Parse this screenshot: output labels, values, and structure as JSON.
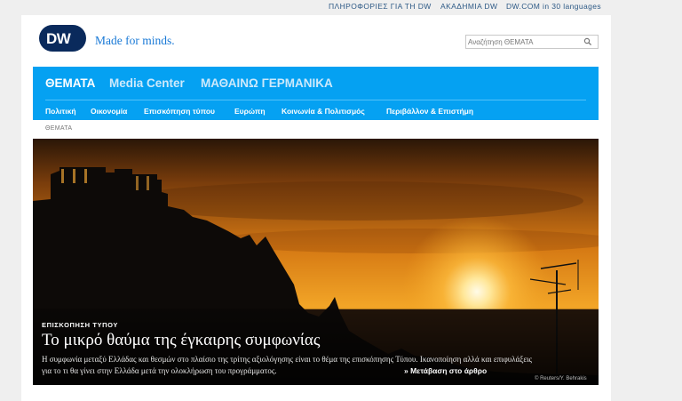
{
  "top_links": [
    {
      "label": "ΠΛΗΡΟΦΟΡΙΕΣ ΓΙΑ ΤΗ DW"
    },
    {
      "label": "ΑΚΑΔΗΜΙΑ DW"
    },
    {
      "label": "DW.COM in 30 languages"
    }
  ],
  "logo": {
    "text": "DW",
    "tagline": "Made for minds.",
    "color": "#0a2a5c"
  },
  "search": {
    "placeholder": "Αναζήτηση ΘΕΜΑΤΑ",
    "value": "",
    "icon": "search-icon"
  },
  "nav": {
    "accent": "#05a1f2",
    "primary": [
      {
        "label": "ΘΕΜΑΤΑ",
        "active": true
      },
      {
        "label": "Media Center",
        "active": false
      },
      {
        "label": "ΜΑΘΑΙΝΩ ΓΕΡΜΑΝΙΚΑ",
        "active": false
      }
    ],
    "secondary": [
      {
        "label": "Πολιτική"
      },
      {
        "label": "Οικονομία"
      },
      {
        "label": "Επισκόπηση τύπου"
      },
      {
        "label": "Ευρώπη"
      },
      {
        "label": "Κοινωνία & Πολιτισμός"
      },
      {
        "label": "Περιβάλλον & Επιστήμη"
      }
    ]
  },
  "breadcrumb": "ΘΕΜΑΤΑ",
  "hero": {
    "kicker": "ΕΠΙΣΚΟΠΗΣΗ ΤΥΠΟΥ",
    "headline": "Το μικρό θαύμα της έγκαιρης συμφωνίας",
    "teaser": "Η συμφωνία μεταξύ Ελλάδας και θεσμών στο πλαίσιο της τρίτης αξιολόγησης είναι το θέμα της επισκόπησης Τύπου. Ικανοποίηση αλλά και επιφυλάξεις για το τι θα γίνει στην Ελλάδα μετά την ολοκλήρωση του προγράμματος.",
    "more_label": "» Μετάβαση στο άρθρο",
    "credit": "© Reuters/Y. Behrakis"
  }
}
